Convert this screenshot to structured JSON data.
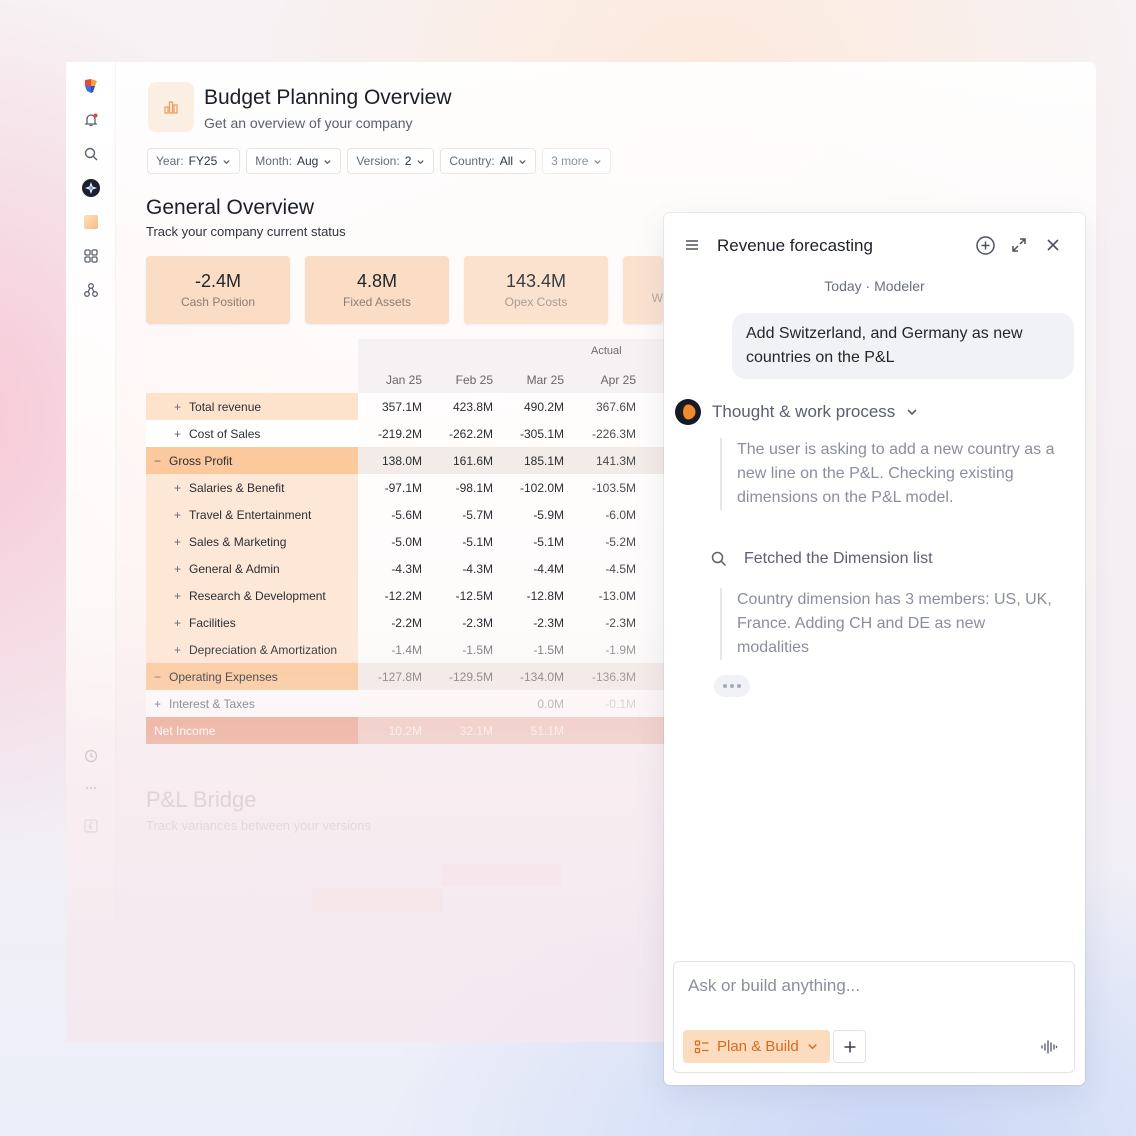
{
  "header": {
    "title": "Budget Planning Overview",
    "subtitle": "Get an overview of your company"
  },
  "filters": [
    {
      "label": "Year:",
      "value": "FY25"
    },
    {
      "label": "Month:",
      "value": "Aug"
    },
    {
      "label": "Version:",
      "value": "2"
    },
    {
      "label": "Country:",
      "value": "All"
    },
    {
      "label": "3 more",
      "value": ""
    }
  ],
  "overview": {
    "title": "General Overview",
    "subtitle": "Track your company current status"
  },
  "kpis": [
    {
      "value": "-2.4M",
      "label": "Cash Position"
    },
    {
      "value": "4.8M",
      "label": "Fixed Assets"
    },
    {
      "value": "143.4M",
      "label": "Opex Costs"
    },
    {
      "value": "",
      "label": "W"
    }
  ],
  "table": {
    "group_header": "Actual",
    "columns": [
      "Jan 25",
      "Feb 25",
      "Mar 25",
      "Apr 25"
    ],
    "rows": [
      {
        "prefix": "+",
        "label": "Total revenue",
        "values": [
          "357.1M",
          "423.8M",
          "490.2M",
          "367.6M"
        ],
        "style": "highlight"
      },
      {
        "prefix": "+",
        "label": "Cost of Sales",
        "values": [
          "-219.2M",
          "-262.2M",
          "-305.1M",
          "-226.3M"
        ],
        "style": "plain"
      },
      {
        "prefix": "−",
        "label": "Gross Profit",
        "values": [
          "138.0M",
          "161.6M",
          "185.1M",
          "141.3M"
        ],
        "style": "group"
      },
      {
        "prefix": "+",
        "label": "Salaries & Benefit",
        "values": [
          "-97.1M",
          "-98.1M",
          "-102.0M",
          "-103.5M"
        ],
        "style": "child"
      },
      {
        "prefix": "+",
        "label": "Travel & Entertainment",
        "values": [
          "-5.6M",
          "-5.7M",
          "-5.9M",
          "-6.0M"
        ],
        "style": "child"
      },
      {
        "prefix": "+",
        "label": "Sales & Marketing",
        "values": [
          "-5.0M",
          "-5.1M",
          "-5.1M",
          "-5.2M"
        ],
        "style": "child"
      },
      {
        "prefix": "+",
        "label": "General & Admin",
        "values": [
          "-4.3M",
          "-4.3M",
          "-4.4M",
          "-4.5M"
        ],
        "style": "child"
      },
      {
        "prefix": "+",
        "label": "Research & Development",
        "values": [
          "-12.2M",
          "-12.5M",
          "-12.8M",
          "-13.0M"
        ],
        "style": "child"
      },
      {
        "prefix": "+",
        "label": "Facilities",
        "values": [
          "-2.2M",
          "-2.3M",
          "-2.3M",
          "-2.3M"
        ],
        "style": "child"
      },
      {
        "prefix": "+",
        "label": "Depreciation & Amortization",
        "values": [
          "-1.4M",
          "-1.5M",
          "-1.5M",
          "-1.9M"
        ],
        "style": "child"
      },
      {
        "prefix": "−",
        "label": "Operating Expenses",
        "values": [
          "-127.8M",
          "-129.5M",
          "-134.0M",
          "-136.3M"
        ],
        "style": "group"
      },
      {
        "prefix": "+",
        "label": "Interest & Taxes",
        "values": [
          "",
          "",
          "0.0M",
          "-0.1M"
        ],
        "style": "plain-flush"
      },
      {
        "prefix": "",
        "label": "Net Income",
        "values": [
          "10.2M",
          "32.1M",
          "51.1M",
          ""
        ],
        "style": "net"
      }
    ]
  },
  "bridge": {
    "title": "P&L Bridge",
    "subtitle": "Track variances between your versions"
  },
  "chat": {
    "title": "Revenue forecasting",
    "meta": "Today · Modeler",
    "user_message": "Add Switzerland, and Germany as new countries on the P&L",
    "thought_label": "Thought & work process",
    "thought_text": "The user is asking to add a new country as a new line on the P&L. Checking existing dimensions on the P&L model.",
    "fetched_label": "Fetched the Dimension list",
    "result_text": "Country dimension has 3 members: US, UK, France. Adding CH and DE as new modalities",
    "input_placeholder": "Ask or build anything...",
    "mode_label": "Plan & Build"
  },
  "colors": {
    "accent": "#d86a1d",
    "kpi_bg": "#fbdcc4",
    "highlight_row": "#fde3cc",
    "group_row": "#fbc99b",
    "net_row": "#e9a38a"
  }
}
